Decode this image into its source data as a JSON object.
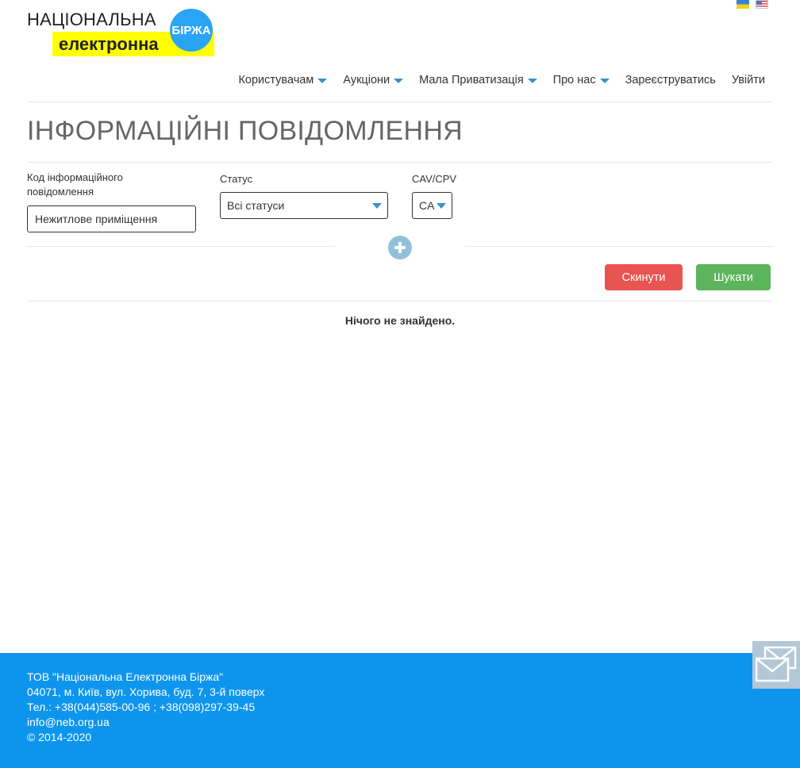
{
  "header": {
    "logo": {
      "line1": "НАЦІОНАЛЬНА",
      "line2": "електронна",
      "badge": "БІРЖА"
    },
    "languages": [
      "ua-flag",
      "en-flag"
    ],
    "nav": [
      {
        "label": "Користувачам",
        "dropdown": true
      },
      {
        "label": "Аукціони",
        "dropdown": true
      },
      {
        "label": "Мала Приватизація",
        "dropdown": true
      },
      {
        "label": "Про нас",
        "dropdown": true
      },
      {
        "label": "Зареєструватись",
        "dropdown": false
      },
      {
        "label": "Увійти",
        "dropdown": false
      }
    ]
  },
  "page": {
    "title": "ІНФОРМАЦІЙНІ ПОВІДОМЛЕННЯ"
  },
  "filters": {
    "code_label_line1": "Код інформаційного",
    "code_label_line2": "повідомлення",
    "code_value": "Нежитлове приміщення",
    "status_label": "Статус",
    "status_value": "Всі статуси",
    "cav_label": "CAV/CPV",
    "cav_value": "CA",
    "expand_icon": "plus-circle-icon"
  },
  "actions": {
    "reset": "Скинути",
    "search": "Шукати"
  },
  "results": {
    "empty_message": "Нічого не знайдено."
  },
  "footer": {
    "company": "ТОВ \"Національна Електронна Біржа\"",
    "address": "04071, м. Київ, вул. Хорива, буд. 7, 3-й поверх",
    "phones": "Тел.: +38(044)585-00-96 ; +38(098)297-39-45",
    "email": "info@neb.org.ua",
    "copyright": "© 2014-2020"
  },
  "colors": {
    "footer_bg": "#0d95ee",
    "reset_button": "#e85450",
    "search_button": "#5cb55c",
    "accent_caret": "#3a92c8",
    "logo_yellow": "#ffff00",
    "logo_badge": "#2aa4f4"
  },
  "widgets": {
    "mail_icon": "mail-icon"
  }
}
